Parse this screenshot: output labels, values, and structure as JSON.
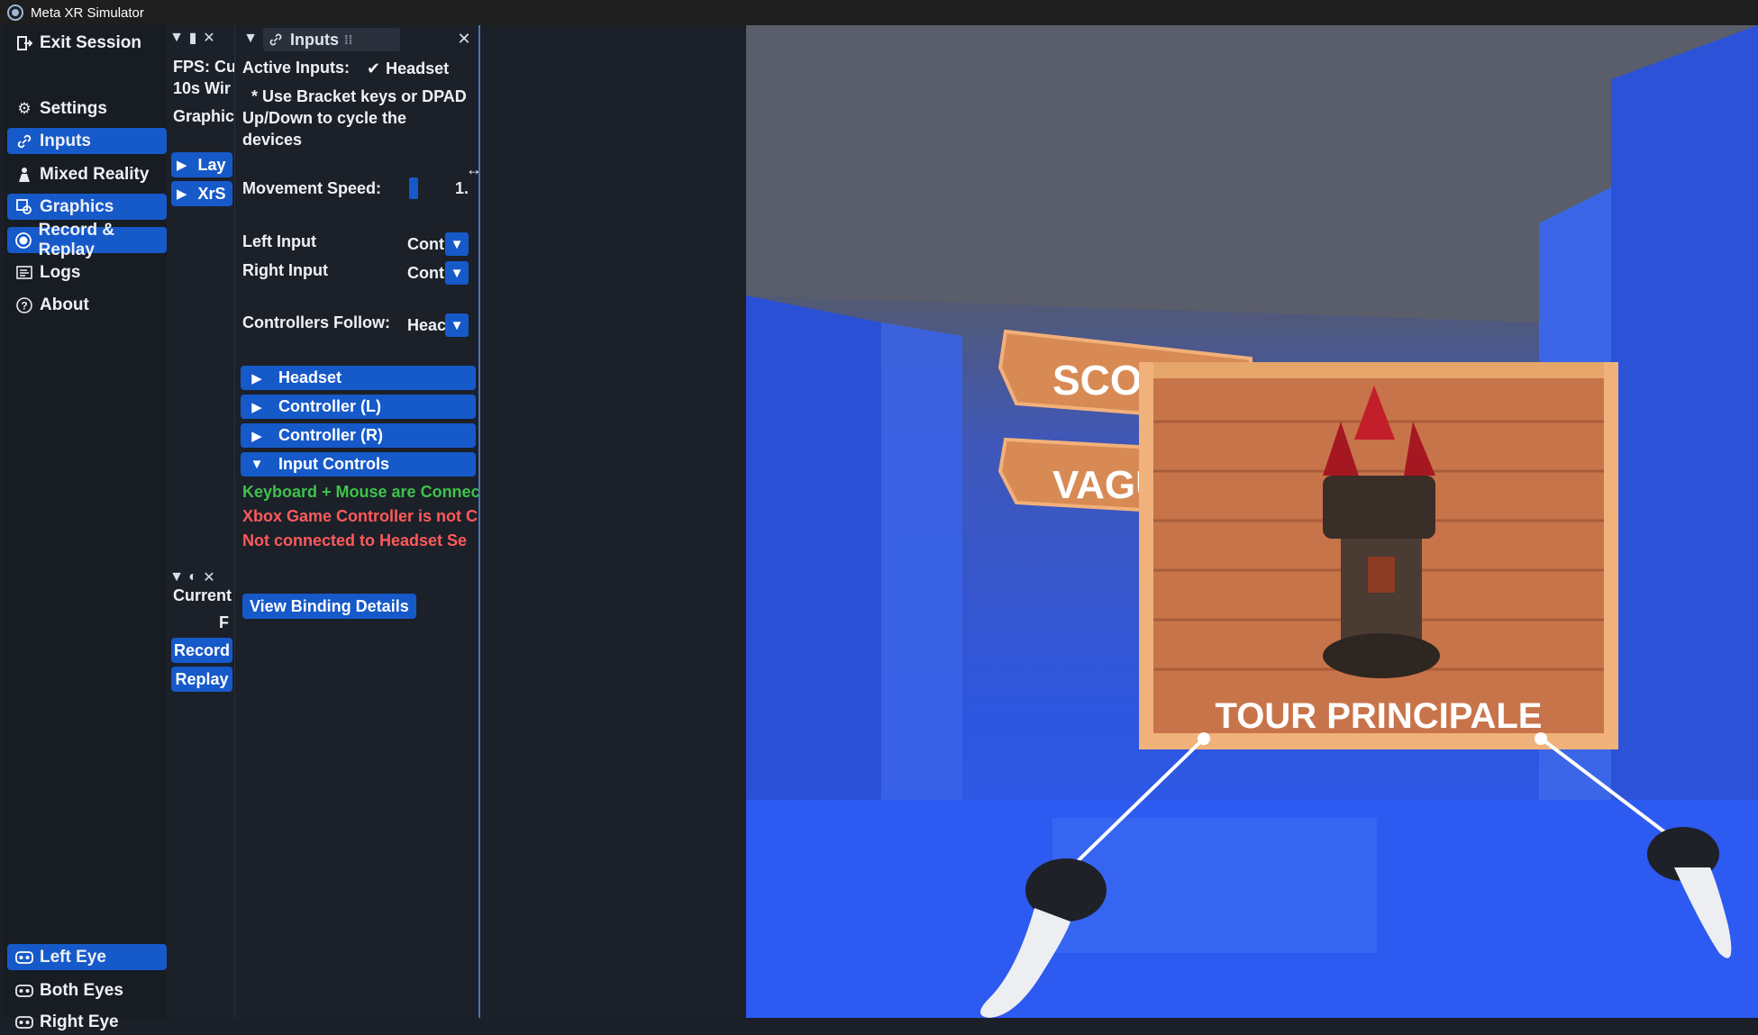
{
  "window": {
    "title": "Meta XR Simulator"
  },
  "sidebar": {
    "top_items": [
      {
        "label": "Exit Session",
        "icon": "exit-icon",
        "active": false
      },
      {
        "label": "Settings",
        "icon": "gear-icon",
        "active": false
      },
      {
        "label": "Inputs",
        "icon": "link-icon",
        "active": true
      },
      {
        "label": "Mixed Reality",
        "icon": "person-icon",
        "active": false
      },
      {
        "label": "Graphics",
        "icon": "graphics-icon",
        "active": true
      },
      {
        "label": "Record & Replay",
        "icon": "record-icon",
        "active": true
      },
      {
        "label": "Logs",
        "icon": "logs-icon",
        "active": false
      },
      {
        "label": "About",
        "icon": "help-icon",
        "active": false
      }
    ],
    "eye_items": [
      {
        "label": "Left Eye",
        "icon": "headset-icon",
        "active": true
      },
      {
        "label": "Both Eyes",
        "icon": "headset-icon",
        "active": false
      },
      {
        "label": "Right Eye",
        "icon": "headset-icon",
        "active": false
      }
    ]
  },
  "stats_panel": {
    "fps_text": "FPS: Cu",
    "window_text": "10s Wir",
    "graphics_text": "Graphic",
    "buttons": [
      "Lay",
      "XrS"
    ]
  },
  "record_panel": {
    "current_text": "Current",
    "f_text": "F",
    "record_label": "Record",
    "replay_label": "Replay"
  },
  "inputs_panel": {
    "tab_title": "Inputs",
    "active_inputs_label": "Active Inputs:",
    "active_device": "Headset",
    "hint": [
      "* Use Bracket keys or DPAD",
      "Up/Down to cycle the",
      "devices"
    ],
    "movement_speed_label": "Movement Speed:",
    "movement_speed_value": "1.",
    "left_input_label": "Left Input",
    "left_input_value": "Cont",
    "right_input_label": "Right Input",
    "right_input_value": "Cont",
    "controllers_follow_label": "Controllers Follow:",
    "controllers_follow_value": "Heac",
    "sections": [
      {
        "label": "Headset",
        "expanded": false
      },
      {
        "label": "Controller (L)",
        "expanded": false
      },
      {
        "label": "Controller (R)",
        "expanded": false
      },
      {
        "label": "Input Controls",
        "expanded": true
      }
    ],
    "status_lines": [
      {
        "text": "Keyboard + Mouse are Connec",
        "status": "ok"
      },
      {
        "text": "Xbox Game Controller is not C",
        "status": "error"
      },
      {
        "text": "Not connected to Headset Se",
        "status": "error"
      }
    ],
    "view_binding_label": "View Binding Details"
  },
  "scene": {
    "sign_top": "SCOI",
    "sign_bottom": "VAGU",
    "board_label": "TOUR PRINCIPALE"
  },
  "colors": {
    "accent": "#1659c9",
    "ok": "#3fc24a",
    "error": "#ff5a5a"
  }
}
